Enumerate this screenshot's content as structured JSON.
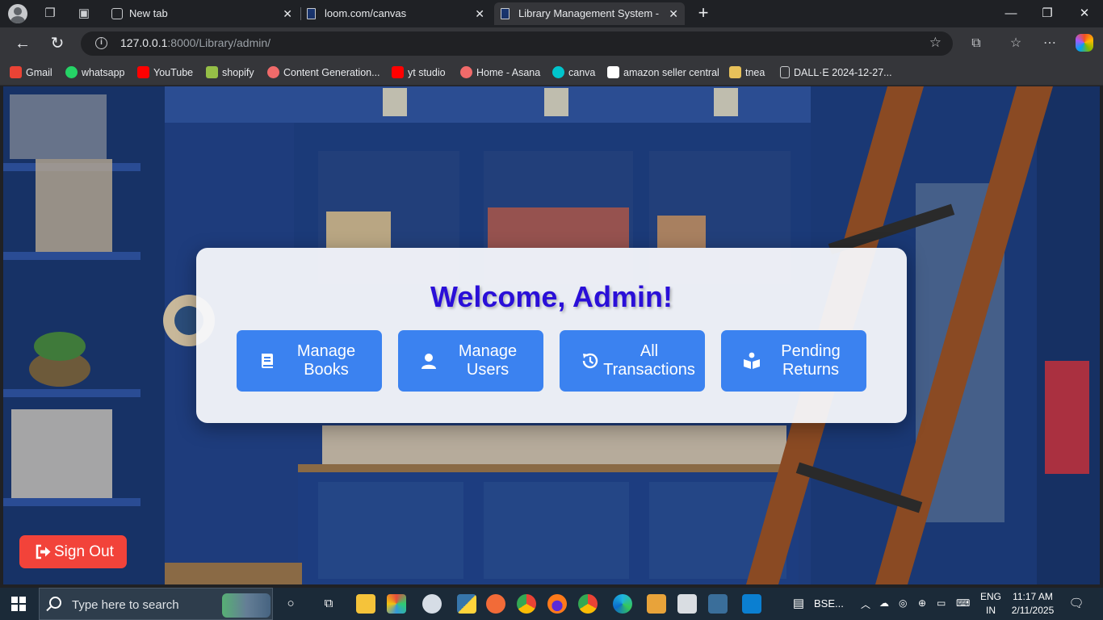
{
  "browser": {
    "tabs": [
      {
        "title": "New tab",
        "active": false
      },
      {
        "title": "loom.com/canvas",
        "active": false
      },
      {
        "title": "Library Management System - Fac",
        "active": true
      }
    ],
    "url_host": "127.0.0.1",
    "url_rest": ":8000/Library/admin/",
    "bookmarks": [
      {
        "label": "Gmail",
        "icon": "gmail-icon",
        "color": "#ea4335"
      },
      {
        "label": "whatsapp",
        "icon": "whatsapp-icon",
        "color": "#25d366"
      },
      {
        "label": "YouTube",
        "icon": "youtube-icon",
        "color": "#ff0000"
      },
      {
        "label": "shopify",
        "icon": "shopify-icon",
        "color": "#95bf47"
      },
      {
        "label": "Content Generation...",
        "icon": "asana-icon",
        "color": "#f06a6a"
      },
      {
        "label": "yt studio",
        "icon": "youtube-icon",
        "color": "#ff0000"
      },
      {
        "label": "Home - Asana",
        "icon": "asana-icon",
        "color": "#f06a6a"
      },
      {
        "label": "canva",
        "icon": "canva-icon",
        "color": "#00c4cc"
      },
      {
        "label": "amazon seller central",
        "icon": "amazon-icon",
        "color": "#ffffff"
      },
      {
        "label": "tnea",
        "icon": "tnea-icon",
        "color": "#e8c15a"
      },
      {
        "label": "DALL·E 2024-12-27...",
        "icon": "file-icon",
        "color": "#c7c9cc"
      }
    ]
  },
  "page": {
    "welcome": "Welcome, Admin!",
    "actions": [
      {
        "label": "Manage Books",
        "icon": "book-icon"
      },
      {
        "label": "Manage Users",
        "icon": "user-icon"
      },
      {
        "label": "All Transactions",
        "icon": "history-icon"
      },
      {
        "label": "Pending Returns",
        "icon": "book-reader-icon"
      }
    ],
    "sign_out": "Sign Out"
  },
  "taskbar": {
    "search_placeholder": "Type here to search",
    "window_label": "BSE...",
    "language_top": "ENG",
    "language_bottom": "IN",
    "time": "11:17 AM",
    "date": "2/11/2025"
  },
  "colors": {
    "accent": "#3b82f0",
    "welcome": "#2a0fd8",
    "sign_out": "#f2433a"
  }
}
